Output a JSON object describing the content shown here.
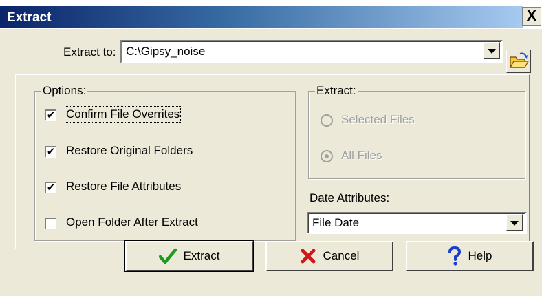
{
  "window": {
    "title": "Extract",
    "close_glyph": "X"
  },
  "extract_to": {
    "label": "Extract to:",
    "value": "C:\\Gipsy_noise"
  },
  "options": {
    "legend": "Options:",
    "items": [
      {
        "label": "Confirm File Overrites",
        "checked": true
      },
      {
        "label": "Restore Original Folders",
        "checked": true
      },
      {
        "label": "Restore File Attributes",
        "checked": true
      },
      {
        "label": "Open Folder After Extract",
        "checked": false
      }
    ]
  },
  "extract_group": {
    "legend": "Extract:",
    "items": [
      {
        "label": "Selected Files",
        "selected": false
      },
      {
        "label": "All Files",
        "selected": true
      }
    ]
  },
  "date_attributes": {
    "label": "Date Attributes:",
    "value": "File Date"
  },
  "buttons": {
    "extract": "Extract",
    "cancel": "Cancel",
    "help": "Help"
  },
  "colors": {
    "title_start": "#0a246a",
    "title_end": "#a6caf0",
    "face": "#ece9d8"
  },
  "icons": {
    "folder": "open-folder-icon",
    "extract": "checkmark-icon",
    "cancel": "x-icon",
    "help": "question-icon"
  }
}
